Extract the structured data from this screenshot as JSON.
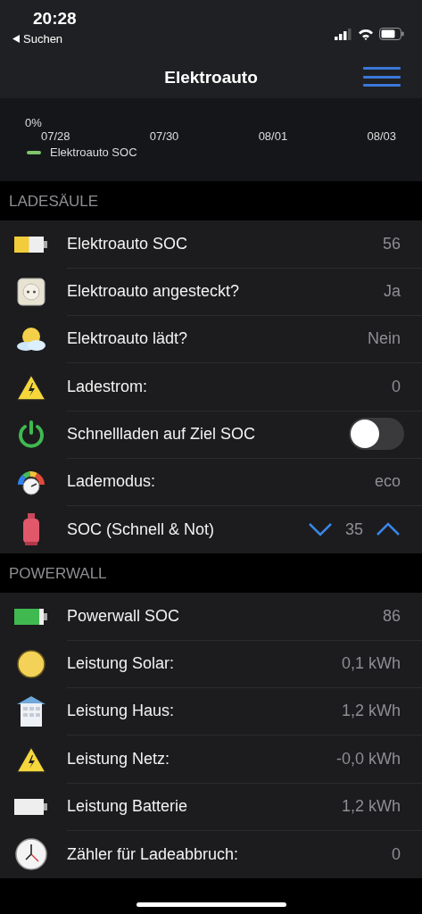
{
  "status_bar": {
    "time": "20:28",
    "back_label": "Suchen"
  },
  "nav_bar": {
    "title": "Elektroauto"
  },
  "chart": {
    "y_label": "0%",
    "x_labels": [
      "07/28",
      "07/30",
      "08/01",
      "08/03"
    ],
    "legend": {
      "label": "Elektroauto SOC",
      "color": "#7ec46a"
    }
  },
  "sections": [
    {
      "title": "LADESÄULE",
      "rows": [
        {
          "kind": "value",
          "label": "Elektroauto SOC",
          "value": "56"
        },
        {
          "kind": "value",
          "label": "Elektroauto angesteckt?",
          "value": "Ja"
        },
        {
          "kind": "value",
          "label": "Elektroauto lädt?",
          "value": "Nein"
        },
        {
          "kind": "value",
          "label": "Ladestrom:",
          "value": "0"
        },
        {
          "kind": "switch",
          "label": "Schnellladen auf Ziel SOC",
          "on": false
        },
        {
          "kind": "value",
          "label": "Lademodus:",
          "value": "eco"
        },
        {
          "kind": "stepper",
          "label": "SOC (Schnell & Not)",
          "value": "35"
        }
      ]
    },
    {
      "title": "POWERWALL",
      "rows": [
        {
          "kind": "value",
          "label": "Powerwall SOC",
          "value": "86"
        },
        {
          "kind": "value",
          "label": "Leistung Solar:",
          "value": "0,1 kWh"
        },
        {
          "kind": "value",
          "label": "Leistung Haus:",
          "value": "1,2 kWh"
        },
        {
          "kind": "value",
          "label": "Leistung Netz:",
          "value": "-0,0 kWh"
        },
        {
          "kind": "value",
          "label": "Leistung Batterie",
          "value": "1,2 kWh"
        },
        {
          "kind": "value",
          "label": "Zähler für Ladeabbruch:",
          "value": "0"
        }
      ]
    }
  ]
}
